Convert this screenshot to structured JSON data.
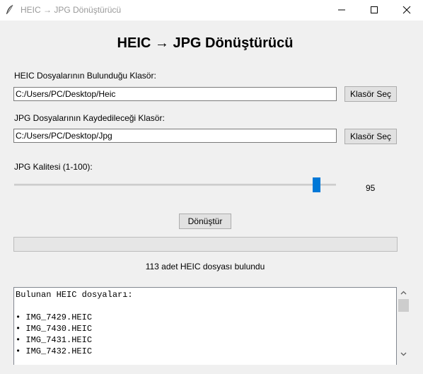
{
  "window": {
    "title": "HEIC → JPG Dönüştürücü",
    "icon": "feather-icon"
  },
  "heading": "HEIC → JPG Dönüştürücü",
  "heic_folder": {
    "label": "HEIC Dosyalarının Bulunduğu Klasör:",
    "value": "C:/Users/PC/Desktop/Heic",
    "button": "Klasör Seç"
  },
  "jpg_folder": {
    "label": "JPG Dosyalarının Kaydedileceği Klasör:",
    "value": "C:/Users/PC/Desktop/Jpg",
    "button": "Klasör Seç"
  },
  "quality": {
    "label": "JPG Kalitesi (1-100):",
    "value": "95",
    "min": 1,
    "max": 100
  },
  "convert_button": "Dönüştür",
  "progress": {
    "fraction": 0
  },
  "status": "113 adet HEIC dosyası bulundu",
  "file_list": {
    "lines": [
      "Bulunan HEIC dosyaları:",
      "",
      "• IMG_7429.HEIC",
      "• IMG_7430.HEIC",
      "• IMG_7431.HEIC",
      "• IMG_7432.HEIC"
    ]
  },
  "colors": {
    "accent": "#0078d7",
    "window_bg": "#f0f0f0"
  }
}
